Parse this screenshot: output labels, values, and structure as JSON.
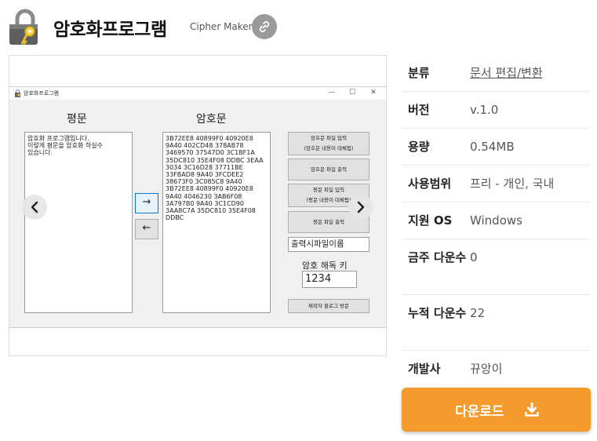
{
  "header": {
    "title": "암호화프로그램",
    "subtitle": "Cipher Maker",
    "link_icon": "link-icon",
    "app_icon": "padlock-key-icon"
  },
  "preview": {
    "window": {
      "title": "암호화프로그램",
      "controls": [
        "—",
        "☐",
        "✕"
      ],
      "plaintext_label": "평문",
      "ciphertext_label": "암호문",
      "plaintext_value": "암호화 프로그램입니다.\n이렇게 평문을 암호화 하실수\n있습니다.",
      "ciphertext_value": "3B72EE8 40899F0 40920E8\n9A40 402CD48 378AB78\n3469570 37547D0 3C1BF1A\n35DC810 35E4F08 DDBC 3EAA\n3034 3C16D28 37711BE\n33FBAD8 9A40 3FCDEE2\n38673F0 3C085C8 9A40\n3B72EE8 40899F0 40920E8\n9A40 4046230 3AB6F08\n3A797B0 9A40 3C1CD90\n3AA8C7A 35DC810 35E4F08\nDDBC",
      "encrypt_arrow": "→",
      "decrypt_arrow": "←",
      "buttons": {
        "cipher_file_input": "암호문 파일 입력",
        "cipher_file_input_note": "(암호문 내용이 대체됨)",
        "cipher_file_output": "암호문 파일 출력",
        "plain_file_input": "평문 파일 입력",
        "plain_file_input_note": "(평문 내용이 대체됨)",
        "plain_file_output": "평문 파일 출력",
        "blog_visit": "제작자 블로그 방문"
      },
      "output_filename": "출력시파일이름",
      "key_label": "암호 해독 키",
      "key_value": "1234"
    },
    "prev_icon": "chevron-left-icon",
    "next_icon": "chevron-right-icon"
  },
  "info": {
    "category_key": "분류",
    "category_val": "문서 편집/변환",
    "version_key": "버전",
    "version_val": "v.1.0",
    "size_key": "용량",
    "size_val": "0.54MB",
    "license_key": "사용범위",
    "license_val": "프리 - 개인, 국내",
    "os_key": "지원 OS",
    "os_val": "Windows",
    "week_dl_key": "금주 다운수",
    "week_dl_val": "0",
    "total_dl_key": "누적 다운수",
    "total_dl_val": "22",
    "developer_key": "개발사",
    "developer_val": "뀨앙이"
  },
  "download": {
    "label": "다운로드",
    "icon": "download-icon"
  },
  "colors": {
    "accent": "#f59a2c",
    "link_circle": "#9a9a9a"
  }
}
